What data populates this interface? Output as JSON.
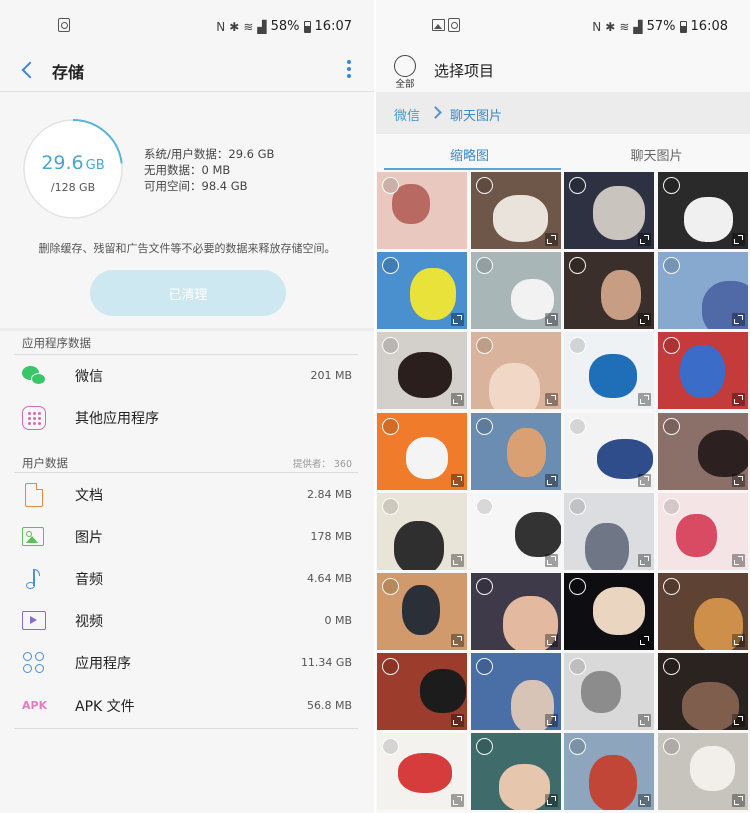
{
  "left": {
    "status": {
      "battery_pct": "58%",
      "time": "16:07"
    },
    "appbar": {
      "title": "存储"
    },
    "storage": {
      "used_value": "29.6",
      "used_unit": "GB",
      "total": "/128 GB",
      "used_fraction": 0.231,
      "stats": {
        "system": "系统/用户数据：29.6 GB",
        "useless": "无用数据：0 MB",
        "free": "可用空间：98.4 GB"
      },
      "description": "删除缓存、残留和广告文件等不必要的数据来释放存储空间。",
      "clean_button": "已清理"
    },
    "app_section": {
      "header": "应用程序数据",
      "items": [
        {
          "label": "微信",
          "size": "201 MB",
          "icon": "wechat-icon"
        },
        {
          "label": "其他应用程序",
          "size": "",
          "icon": "apps-grid-icon"
        }
      ]
    },
    "user_section": {
      "header": "用户数据",
      "provider": "提供者：  360",
      "items": [
        {
          "label": "文档",
          "size": "2.84 MB",
          "icon": "document-icon"
        },
        {
          "label": "图片",
          "size": "178 MB",
          "icon": "image-icon"
        },
        {
          "label": "音频",
          "size": "4.64 MB",
          "icon": "music-note-icon"
        },
        {
          "label": "视频",
          "size": "0 MB",
          "icon": "video-icon"
        },
        {
          "label": "应用程序",
          "size": "11.34 GB",
          "icon": "app-circles-icon"
        },
        {
          "label": "APK 文件",
          "size": "56.8 MB",
          "icon": "apk-icon",
          "icon_text": "APK"
        }
      ]
    },
    "colors": {
      "accent": "#3a8ad1",
      "gauge": "#4aa6cf",
      "button": "#cde8f1"
    }
  },
  "right": {
    "status": {
      "battery_pct": "57%",
      "time": "16:08"
    },
    "select_all_label": "全部",
    "title": "选择项目",
    "breadcrumb": {
      "root": "微信",
      "current": "聊天图片"
    },
    "tabs": {
      "active": "缩略图",
      "inactive": "聊天图片"
    },
    "thumbnails": [
      {
        "bg": "#e9c8c0",
        "fg": "#b86a62",
        "expand": false
      },
      {
        "bg": "#6e5648",
        "fg": "#e9e3dc",
        "expand": true
      },
      {
        "bg": "#2d3142",
        "fg": "#c9c4bd",
        "expand": true
      },
      {
        "bg": "#2a2a2a",
        "fg": "#f0f0f0",
        "expand": true
      },
      {
        "bg": "#4a8fce",
        "fg": "#e8e23a",
        "expand": true
      },
      {
        "bg": "#a8b6b8",
        "fg": "#f2f2f2",
        "expand": true
      },
      {
        "bg": "#3a2f2a",
        "fg": "#c79d84",
        "expand": true
      },
      {
        "bg": "#87a9cf",
        "fg": "#4f6aa6",
        "expand": true
      },
      {
        "bg": "#d3cfcb",
        "fg": "#2a1f1c",
        "expand": true
      },
      {
        "bg": "#d9b39c",
        "fg": "#f1d7c6",
        "expand": true
      },
      {
        "bg": "#eef2f5",
        "fg": "#1f6fb8",
        "expand": true
      },
      {
        "bg": "#c53b3b",
        "fg": "#3b6cc7",
        "expand": true
      },
      {
        "bg": "#ef7b2b",
        "fg": "#f4f4f4",
        "expand": true
      },
      {
        "bg": "#6b8db1",
        "fg": "#d9a073",
        "expand": true
      },
      {
        "bg": "#f3f3f3",
        "fg": "#2f4c8b",
        "expand": true
      },
      {
        "bg": "#8b6f69",
        "fg": "#2d2021",
        "expand": true
      },
      {
        "bg": "#e9e4d8",
        "fg": "#2f2f2f",
        "expand": true
      },
      {
        "bg": "#f6f6f6",
        "fg": "#333333",
        "expand": true
      },
      {
        "bg": "#dcdde0",
        "fg": "#6f7686",
        "expand": true
      },
      {
        "bg": "#f4e4e6",
        "fg": "#d94b63",
        "expand": true
      },
      {
        "bg": "#d19a6c",
        "fg": "#2b3038",
        "expand": true
      },
      {
        "bg": "#3e3a49",
        "fg": "#e3b9a0",
        "expand": true
      },
      {
        "bg": "#0e0e12",
        "fg": "#ead6c0",
        "expand": true
      },
      {
        "bg": "#5e4234",
        "fg": "#ce8f4a",
        "expand": true
      },
      {
        "bg": "#9b3c2c",
        "fg": "#1c1c1c",
        "expand": true
      },
      {
        "bg": "#4a6fa7",
        "fg": "#d8c4b7",
        "expand": true
      },
      {
        "bg": "#d9d9d9",
        "fg": "#8c8c8c",
        "expand": true
      },
      {
        "bg": "#2b2320",
        "fg": "#7f5e4e",
        "expand": true
      },
      {
        "bg": "#f4f2ef",
        "fg": "#d63c3c",
        "expand": true
      },
      {
        "bg": "#3f6c6a",
        "fg": "#e7c6ae",
        "expand": true
      },
      {
        "bg": "#8da6bd",
        "fg": "#c24638",
        "expand": true
      },
      {
        "bg": "#c7c3bd",
        "fg": "#f2efea",
        "expand": true
      }
    ]
  }
}
